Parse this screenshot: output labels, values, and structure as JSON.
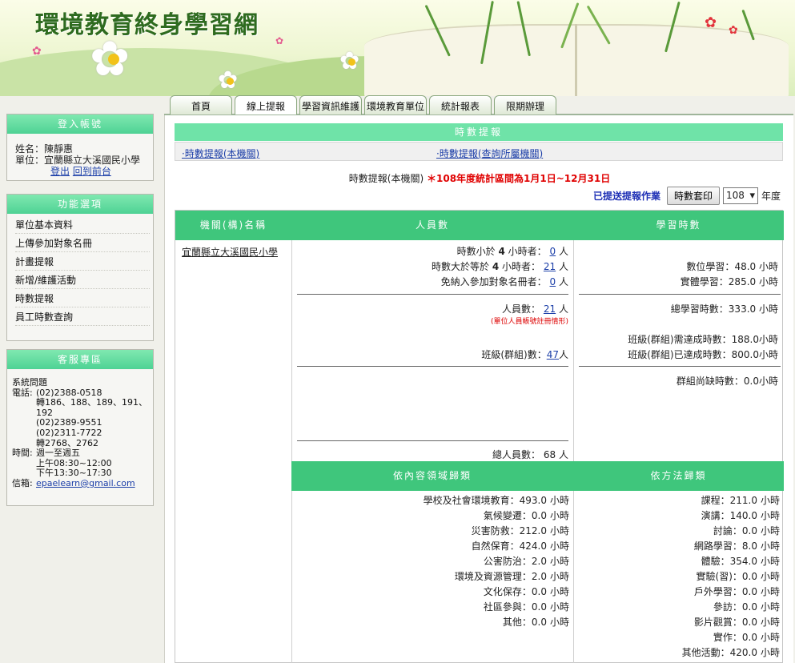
{
  "header": {
    "title": "環境教育終身學習網"
  },
  "tabs": [
    {
      "label": "首頁"
    },
    {
      "label": "線上提報"
    },
    {
      "label": "學習資訊維護"
    },
    {
      "label": "環境教育單位"
    },
    {
      "label": "統計報表"
    },
    {
      "label": "限期辦理"
    }
  ],
  "login": {
    "heading": "登入帳號",
    "name_key": "姓名：",
    "name_value": "陳靜惠",
    "unit_key": "單位：",
    "unit_value": "宜蘭縣立大溪國民小學",
    "logout_label": "登出",
    "home_label": "回到前台"
  },
  "menu": {
    "heading": "功能選項",
    "items": [
      {
        "label": "單位基本資料"
      },
      {
        "label": "上傳參加對象名冊"
      },
      {
        "label": "計畫提報"
      },
      {
        "label": "新增/維護活動"
      },
      {
        "label": "時數提報"
      },
      {
        "label": "員工時數查詢"
      }
    ]
  },
  "service": {
    "heading": "客服專區",
    "topic": "系統問題",
    "phone_key": "電話:",
    "phone_lines": [
      "(02)2388-0518",
      "轉186、188、189、191、",
      "192",
      "(02)2389-9551",
      "(02)2311-7722",
      "轉2768、2762"
    ],
    "time_key": "時間:",
    "time_lines": [
      "週一至週五",
      "上午08:30~12:00",
      "下午13:30~17:30"
    ],
    "mail_key": "信箱:",
    "mail_value": "epaelearn@gmail.com"
  },
  "main": {
    "title": "時數提報",
    "link_self": "·時數提報(本機關)",
    "link_sub": "·時數提報(查詢所屬機關)",
    "caption": "時數提報(本機關)",
    "note": "＊108年度統計區間為1月1日~12月31日",
    "submitted_label": "已提送提報作業",
    "print_button": "時數套印",
    "year_value": "108",
    "year_unit": "年度"
  },
  "stats": {
    "col_org": "機關(構)名稱",
    "col_people": "人員數",
    "col_hours": "學習時數",
    "org_name": "宜蘭縣立大溪國民小學",
    "people": {
      "lt4_label": "時數小於",
      "lt4_bold": "4",
      "lt4_suffix": "小時者：",
      "lt4_value": "0",
      "ge4_label": "時數大於等於",
      "ge4_bold": "4",
      "ge4_suffix": "小時者：",
      "ge4_value": "21",
      "exempt_label": "免納入參加對象名冊者：",
      "exempt_value": "0",
      "unit": "人",
      "staff_label": "人員數：",
      "staff_value": "21",
      "staff_note": "(單位人員帳號註冊情形)",
      "class_label": "班級(群組)數：",
      "class_value": "47",
      "total_label": "總人員數：",
      "total_value": "68"
    },
    "hours": {
      "digital_label": "數位學習：",
      "digital_value": "48.0",
      "physical_label": "實體學習：",
      "physical_value": "285.0",
      "total_label": "總學習時數：",
      "total_value": "333.0",
      "class_need_label": "班級(群組)需達成時數：",
      "class_need_value": "188.0",
      "class_done_label": "班級(群組)已達成時數：",
      "class_done_value": "800.0",
      "class_short_label": "群組尚缺時數：",
      "class_short_value": "0.0",
      "unit": "小時"
    },
    "col_domain": "依內容領域歸類",
    "col_method": "依方法歸類",
    "domains": [
      {
        "label": "學校及社會環境教育：",
        "value": "493.0"
      },
      {
        "label": "氣候變遷：",
        "value": "0.0"
      },
      {
        "label": "災害防救：",
        "value": "212.0"
      },
      {
        "label": "自然保育：",
        "value": "424.0"
      },
      {
        "label": "公害防治：",
        "value": "2.0"
      },
      {
        "label": "環境及資源管理：",
        "value": "2.0"
      },
      {
        "label": "文化保存：",
        "value": "0.0"
      },
      {
        "label": "社區參與：",
        "value": "0.0"
      },
      {
        "label": "其他：",
        "value": "0.0"
      }
    ],
    "methods": [
      {
        "label": "課程：",
        "value": "211.0"
      },
      {
        "label": "演講：",
        "value": "140.0"
      },
      {
        "label": "討論：",
        "value": "0.0"
      },
      {
        "label": "網路學習：",
        "value": "8.0"
      },
      {
        "label": "體驗：",
        "value": "354.0"
      },
      {
        "label": "實驗(習)：",
        "value": "0.0"
      },
      {
        "label": "戶外學習：",
        "value": "0.0"
      },
      {
        "label": "參訪：",
        "value": "0.0"
      },
      {
        "label": "影片觀賞：",
        "value": "0.0"
      },
      {
        "label": "實作：",
        "value": "0.0"
      },
      {
        "label": "其他活動：",
        "value": "420.0"
      }
    ]
  }
}
